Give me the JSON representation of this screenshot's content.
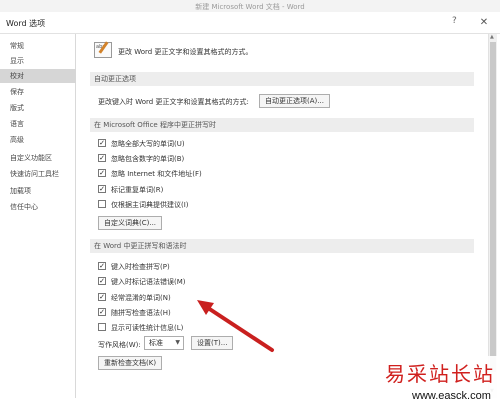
{
  "app_title": "新建 Microsoft Word 文档 - Word",
  "dialog": {
    "title": "Word 选项",
    "help": "?",
    "close": "✕"
  },
  "sidebar": {
    "items": [
      {
        "label": "常规"
      },
      {
        "label": "显示"
      },
      {
        "label": "校对",
        "active": true
      },
      {
        "label": "保存"
      },
      {
        "label": "版式"
      },
      {
        "label": "语言"
      },
      {
        "label": "高级"
      },
      {
        "label": "自定义功能区"
      },
      {
        "label": "快速访问工具栏"
      },
      {
        "label": "加载项"
      },
      {
        "label": "信任中心"
      }
    ]
  },
  "intro": {
    "text": "更改 Word 更正文字和设置其格式的方式。",
    "icon": "abc-pen-icon"
  },
  "autocorrect": {
    "header": "自动更正选项",
    "desc": "更改键入时 Word 更正文字和设置其格式的方式:",
    "button": "自动更正选项(A)..."
  },
  "office": {
    "header": "在 Microsoft Office 程序中更正拼写时",
    "options": [
      {
        "label": "忽略全部大写的单词(U)",
        "checked": true
      },
      {
        "label": "忽略包含数字的单词(B)",
        "checked": true
      },
      {
        "label": "忽略 Internet 和文件地址(F)",
        "checked": true
      },
      {
        "label": "标记重复单词(R)",
        "checked": true
      },
      {
        "label": "仅根据主词典提供建议(I)",
        "checked": false
      }
    ],
    "button": "自定义词典(C)..."
  },
  "word": {
    "header": "在 Word 中更正拼写和语法时",
    "options": [
      {
        "label": "键入时检查拼写(P)",
        "checked": true
      },
      {
        "label": "键入时标记语法错误(M)",
        "checked": true
      },
      {
        "label": "经常混淆的单词(N)",
        "checked": true
      },
      {
        "label": "随拼写检查语法(H)",
        "checked": true
      },
      {
        "label": "显示可读性统计信息(L)",
        "checked": false
      }
    ],
    "style_label": "写作风格(W):",
    "style_value": "标准",
    "settings_button": "设置(T)...",
    "recheck_button": "重新检查文档(K)"
  },
  "watermark": {
    "cn": "易采站长站",
    "url": "www.easck.com"
  },
  "colors": {
    "arrow": "#c9201f",
    "active_nav": "#d6d6d6",
    "section_bg": "#ededed"
  },
  "checkmark": "✓"
}
